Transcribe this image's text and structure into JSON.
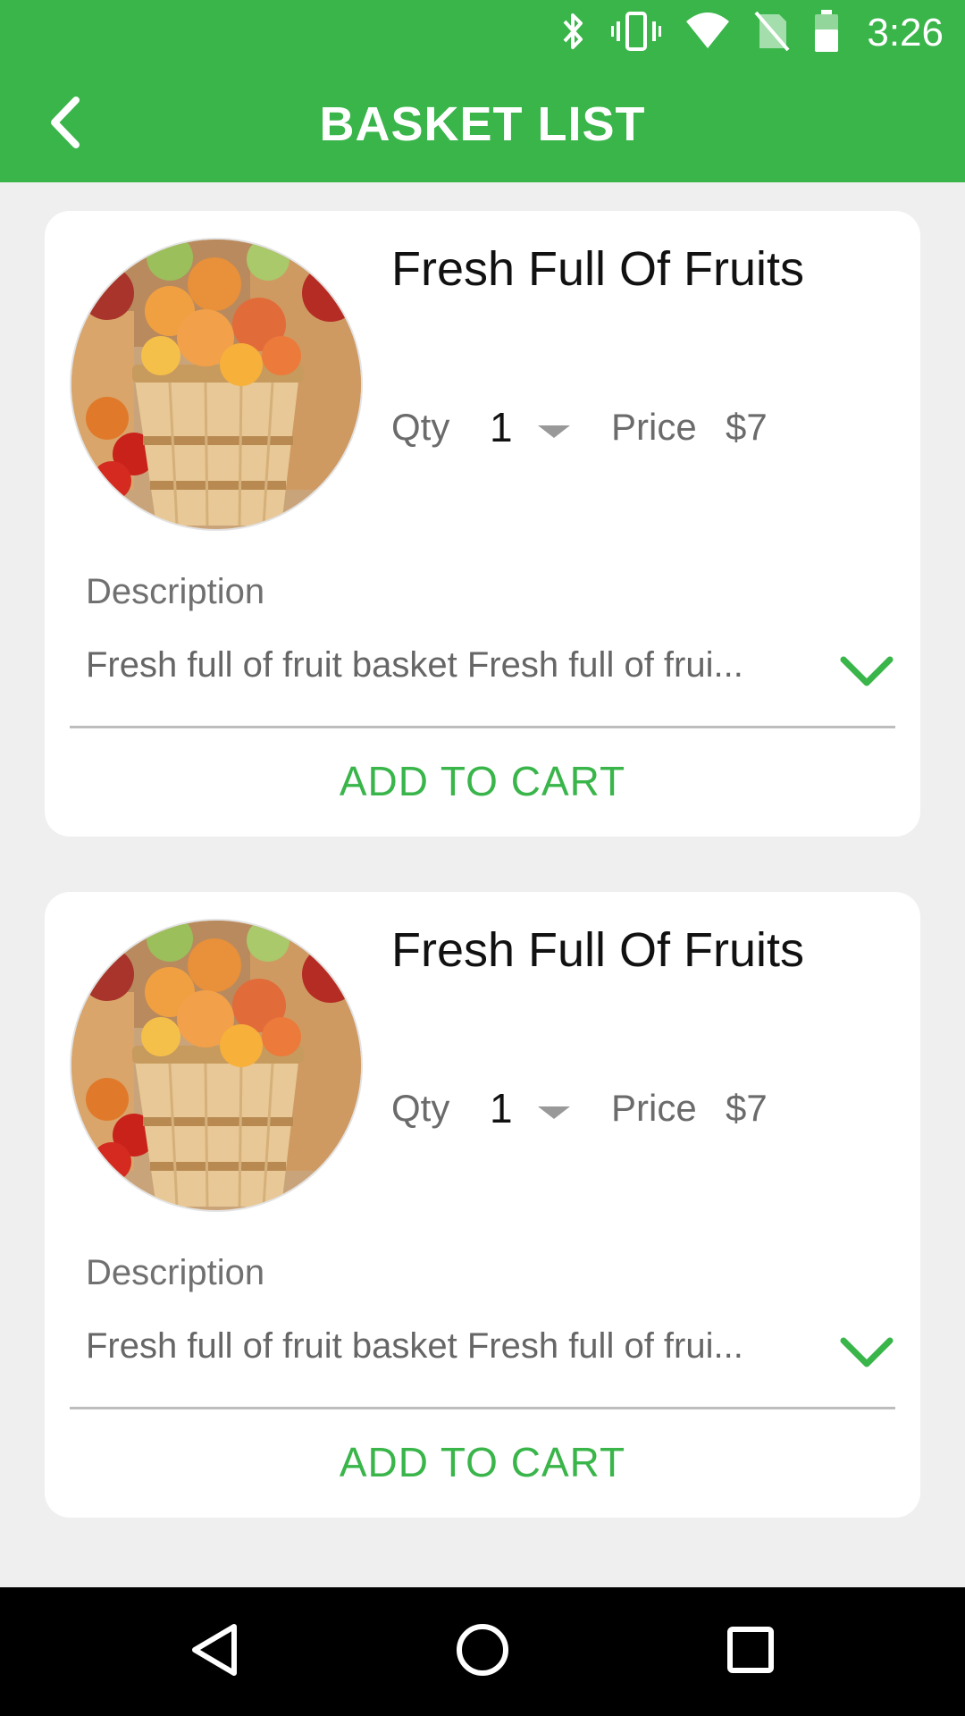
{
  "status_bar": {
    "time": "3:26",
    "icons": [
      "bluetooth-icon",
      "vibrate-icon",
      "wifi-icon",
      "no-sim-icon",
      "battery-icon"
    ]
  },
  "app_bar": {
    "title": "BASKET LIST",
    "back_icon": "chevron-left-icon"
  },
  "colors": {
    "accent": "#39b54a",
    "background": "#efefef",
    "card": "#ffffff"
  },
  "products": [
    {
      "name": "Fresh Full Of Fruits",
      "qty_label": "Qty",
      "qty": "1",
      "price_label": "Price",
      "price": "$7",
      "description_label": "Description",
      "description": "Fresh full of fruit basket Fresh full of frui...",
      "add_to_cart": "ADD TO CART",
      "image": "fruit-basket-image"
    },
    {
      "name": "Fresh Full Of Fruits",
      "qty_label": "Qty",
      "qty": "1",
      "price_label": "Price",
      "price": "$7",
      "description_label": "Description",
      "description": "Fresh full of fruit basket Fresh full of frui...",
      "add_to_cart": "ADD TO CART",
      "image": "fruit-basket-image"
    }
  ],
  "nav_bar": {
    "icons": [
      "back-triangle-icon",
      "home-circle-icon",
      "recents-square-icon"
    ]
  }
}
